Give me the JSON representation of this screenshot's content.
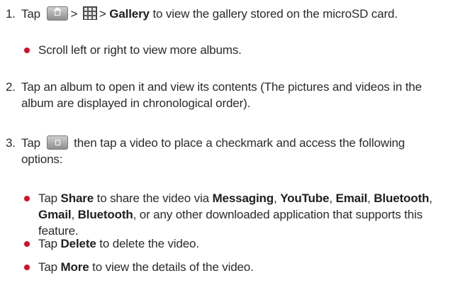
{
  "step1": {
    "num": "1.",
    "tap": "Tap",
    "sep1": ">",
    "sep2": ">",
    "gallery": "Gallery",
    "rest": "to view the gallery stored on the microSD card."
  },
  "bullet_scroll": "Scroll left or right to view more albums.",
  "step2": {
    "num": "2.",
    "line1": "Tap an album to open it and view its contents (The pictures and videos in the",
    "line2": "album are displayed in chronological order)."
  },
  "step3": {
    "num": "3.",
    "tap": "Tap",
    "rest1": "then tap a video to place a checkmark and access the following",
    "rest2": "options:"
  },
  "share": {
    "tap": "Tap",
    "share": "Share",
    "t1": "to share the video via",
    "messaging": "Messaging",
    "youtube": "YouTube",
    "email": "Email",
    "bluetooth1": "Bluetooth",
    "gmail": "Gmail",
    "bluetooth2": "Bluetooth",
    "t2": ", or any other downloaded application that supports this",
    "t3": "feature."
  },
  "delete": {
    "tap": "Tap",
    "label": "Delete",
    "rest": "to delete the video."
  },
  "more": {
    "tap": "Tap",
    "label": "More",
    "rest": "to view the details of the video."
  },
  "colors": {
    "bullet": "#d0112b",
    "text": "#2b2b2b"
  },
  "icons": [
    "home-key-icon",
    "applications-grid-icon",
    "menu-key-icon"
  ]
}
